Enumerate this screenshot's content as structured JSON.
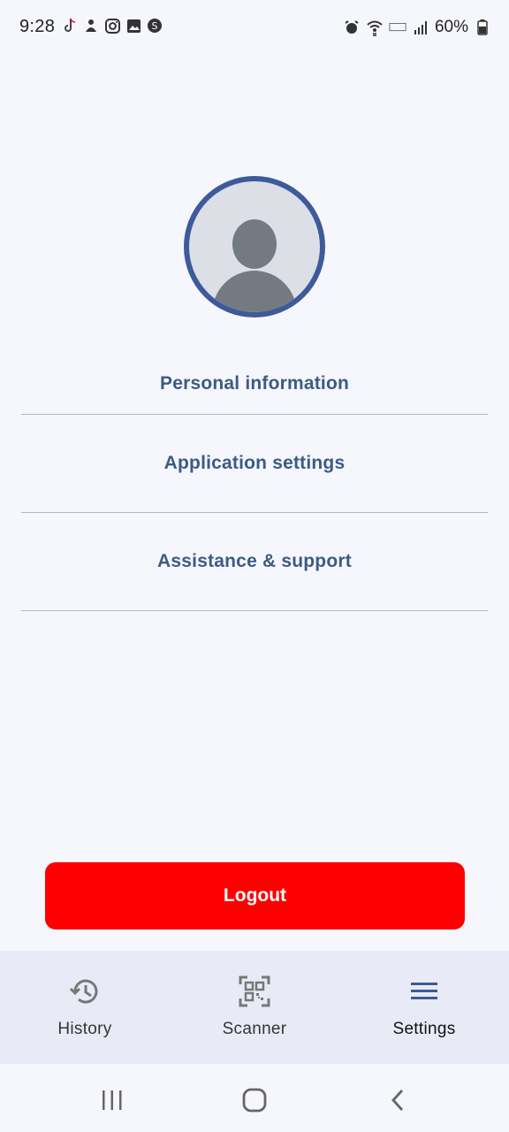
{
  "status_bar": {
    "time": "9:28",
    "battery": "60%",
    "left_icons": [
      "tiktok-icon",
      "notification-icon",
      "instagram-icon",
      "gallery-icon",
      "shazam-icon"
    ],
    "right_icons": [
      "alarm-icon",
      "wifi-icon",
      "volte-icon",
      "signal-icon",
      "battery-icon"
    ]
  },
  "profile": {
    "avatar_icon": "person-icon",
    "accent_color": "#3d5a9b"
  },
  "menu": {
    "items": [
      {
        "label": "Personal information"
      },
      {
        "label": "Application settings"
      },
      {
        "label": "Assistance & support"
      }
    ]
  },
  "logout": {
    "label": "Logout",
    "color": "#ff0000"
  },
  "bottom_nav": {
    "items": [
      {
        "label": "History",
        "icon": "history-icon"
      },
      {
        "label": "Scanner",
        "icon": "qr-scanner-icon"
      },
      {
        "label": "Settings",
        "icon": "menu-icon",
        "active": true
      }
    ]
  },
  "system_nav": [
    "recent-apps-icon",
    "home-icon",
    "back-icon"
  ]
}
